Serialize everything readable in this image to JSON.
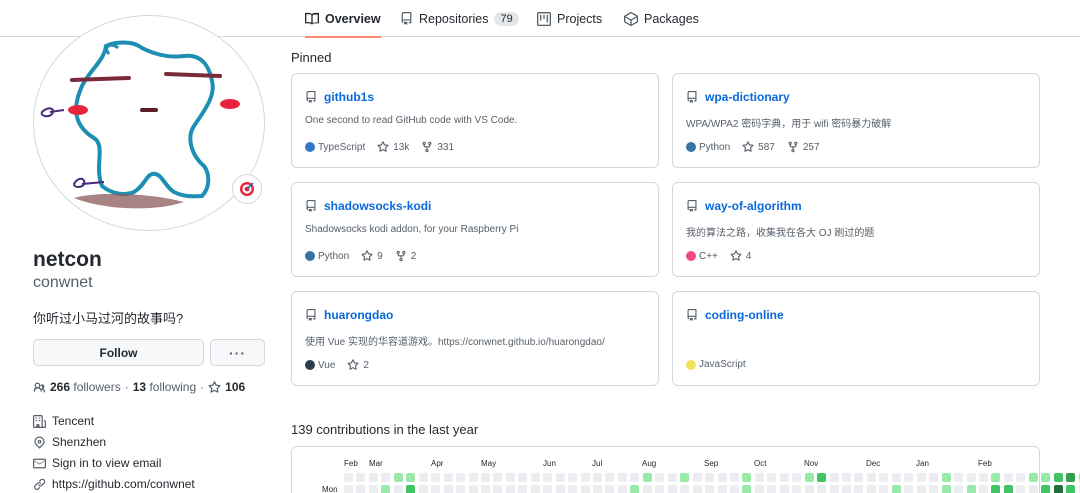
{
  "nav": {
    "tabs": [
      {
        "label": "Overview",
        "icon": "book-icon",
        "selected": true
      },
      {
        "label": "Repositories",
        "icon": "repo-icon",
        "count": "79"
      },
      {
        "label": "Projects",
        "icon": "project-icon"
      },
      {
        "label": "Packages",
        "icon": "package-icon"
      }
    ]
  },
  "profile": {
    "fullname": "netcon",
    "username": "conwnet",
    "bio": "你听过小马过河的故事吗?",
    "follow_label": "Follow",
    "more_label": "···",
    "followers_count": "266",
    "followers_label": "followers",
    "following_count": "13",
    "following_label": "following",
    "stars_count": "106",
    "company": "Tencent",
    "location": "Shenzhen",
    "email": "Sign in to view email",
    "website": "https://github.com/conwnet"
  },
  "pinned": {
    "title": "Pinned",
    "repos": [
      {
        "name": "github1s",
        "desc": "One second to read GitHub code with VS Code.",
        "lang": "TypeScript",
        "lang_color": "#3178c6",
        "stars": "13k",
        "forks": "331"
      },
      {
        "name": "wpa-dictionary",
        "desc": "WPA/WPA2 密码字典，用于 wifi 密码暴力破解",
        "lang": "Python",
        "lang_color": "#3572A5",
        "stars": "587",
        "forks": "257"
      },
      {
        "name": "shadowsocks-kodi",
        "desc": "Shadowsocks kodi addon, for your Raspberry Pi",
        "lang": "Python",
        "lang_color": "#3572A5",
        "stars": "9",
        "forks": "2"
      },
      {
        "name": "way-of-algorithm",
        "desc": "我的算法之路，收集我在各大 OJ 刷过的题",
        "lang": "C++",
        "lang_color": "#f34b7d",
        "stars": "4",
        "forks": ""
      },
      {
        "name": "huarongdao",
        "desc": "使用 Vue 实现的华容道游戏。https://conwnet.github.io/huarongdao/",
        "lang": "Vue",
        "lang_color": "#41b883",
        "stars": "2",
        "forks": ""
      },
      {
        "name": "coding-online",
        "desc": "",
        "lang": "JavaScript",
        "lang_color": "#f1e05a",
        "stars": "",
        "forks": ""
      }
    ]
  },
  "contributions": {
    "title": "139 contributions in the last year",
    "months": [
      "Feb",
      "Mar",
      "Apr",
      "May",
      "Jun",
      "Jul",
      "Aug",
      "Sep",
      "Oct",
      "Nov",
      "Dec",
      "Jan",
      "Feb"
    ],
    "day_label": "Mon"
  },
  "colors": {
    "link": "#0969da",
    "tab_underline": "#fd8c73",
    "contrib_empty": "#ebedf0",
    "contrib_levels": [
      "#9be9a8",
      "#40c463",
      "#30a14e",
      "#216e39"
    ]
  }
}
